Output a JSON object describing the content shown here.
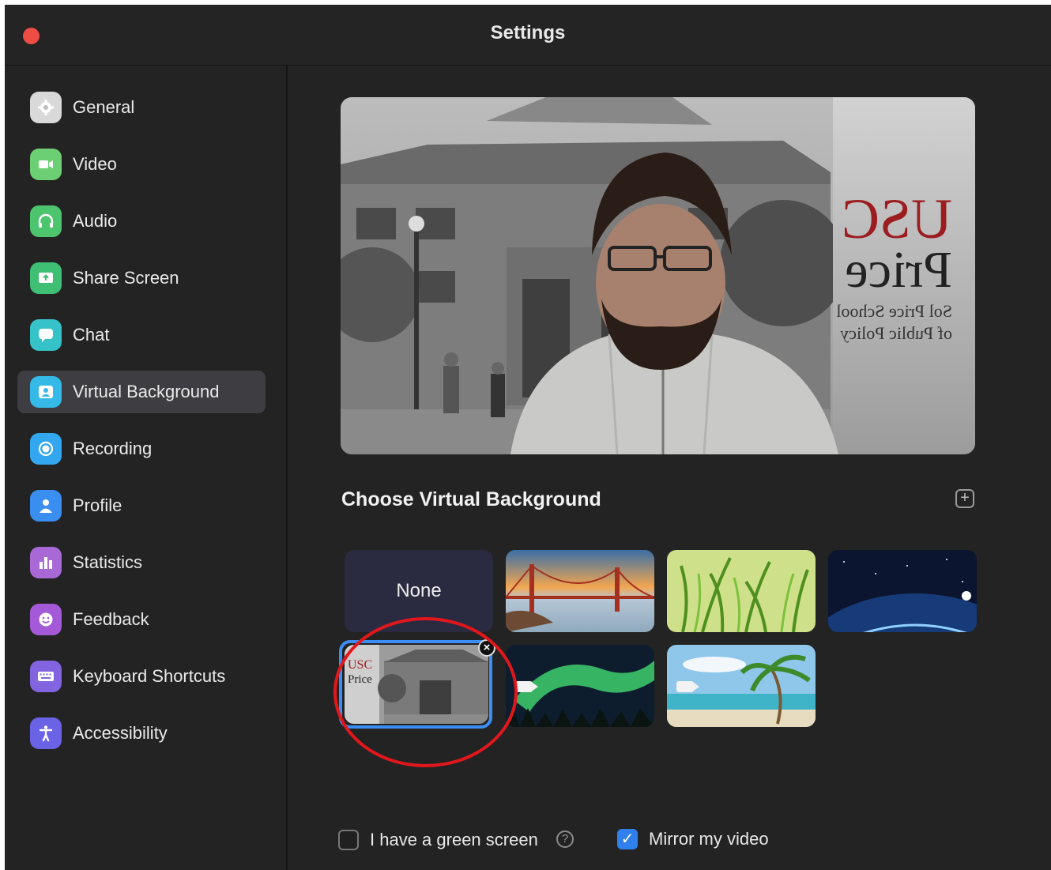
{
  "window": {
    "title": "Settings"
  },
  "sidebar": {
    "items": [
      {
        "label": "General",
        "icon": "gear-icon",
        "color": "#d9d9d9"
      },
      {
        "label": "Video",
        "icon": "video-camera-icon",
        "color": "#6ccf73"
      },
      {
        "label": "Audio",
        "icon": "headphones-icon",
        "color": "#4dc46e"
      },
      {
        "label": "Share Screen",
        "icon": "share-screen-icon",
        "color": "#3fbf74"
      },
      {
        "label": "Chat",
        "icon": "chat-bubble-icon",
        "color": "#36c2c9"
      },
      {
        "label": "Virtual Background",
        "icon": "person-portrait-icon",
        "color": "#35b9e6",
        "active": true
      },
      {
        "label": "Recording",
        "icon": "record-icon",
        "color": "#33a6f0"
      },
      {
        "label": "Profile",
        "icon": "person-icon",
        "color": "#3a8ef0"
      },
      {
        "label": "Statistics",
        "icon": "bar-chart-icon",
        "color": "#a869d6"
      },
      {
        "label": "Feedback",
        "icon": "smiley-icon",
        "color": "#a45ad8"
      },
      {
        "label": "Keyboard Shortcuts",
        "icon": "keyboard-icon",
        "color": "#8264e0"
      },
      {
        "label": "Accessibility",
        "icon": "accessibility-icon",
        "color": "#6b63e6"
      }
    ]
  },
  "main": {
    "preview": {
      "logo_line1": "USC",
      "logo_line2": "Price",
      "logo_line3": "Sol Price School",
      "logo_line4": "of Public Policy"
    },
    "section_title": "Choose Virtual Background",
    "add_icon": "plus-icon",
    "backgrounds": [
      {
        "label": "None"
      },
      {
        "name": "golden-gate-bridge"
      },
      {
        "name": "green-grass"
      },
      {
        "name": "earth-from-space"
      },
      {
        "name": "usc-price-campus",
        "selected": true,
        "logo": "USC",
        "logo2": "Price"
      },
      {
        "name": "aurora-borealis",
        "video": true
      },
      {
        "name": "tropical-beach",
        "video": true
      }
    ],
    "options": {
      "green_screen_label": "I have a green screen",
      "green_screen_checked": false,
      "help_icon": "?",
      "mirror_label": "Mirror my video",
      "mirror_checked": true
    }
  },
  "accent_color": "#2f80ed",
  "annotation_color": "#e2171c"
}
